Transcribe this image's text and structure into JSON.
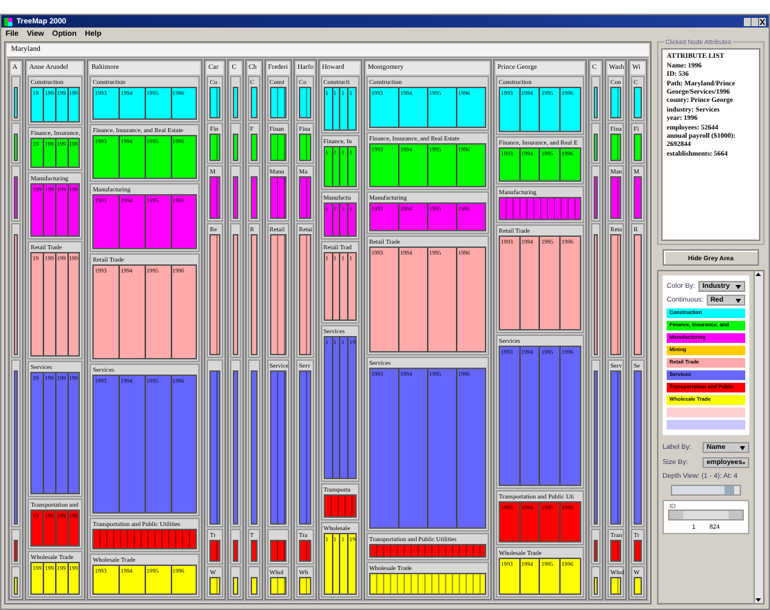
{
  "window": {
    "title": "TreeMap 2000"
  },
  "menu": [
    "File",
    "View",
    "Option",
    "Help"
  ],
  "treemap": {
    "root": "Maryland",
    "counties": [
      {
        "name": "A",
        "sectors": [
          {
            "color": "#00ffff"
          },
          {
            "color": "#00ff00"
          },
          {
            "color": "#ff00ff"
          },
          {
            "color": "#ffaaaa"
          },
          {
            "color": "#6666ff"
          },
          {
            "color": "#ff0000"
          },
          {
            "color": "#ffff00"
          }
        ]
      },
      {
        "name": "Anne Arundel",
        "sectors": [
          {
            "label": "Construction",
            "color": "#00ffff",
            "years": [
              "19",
              "199",
              "199",
              "199"
            ]
          },
          {
            "label": "Finance, Insurance,",
            "color": "#00ff00",
            "years": [
              "19",
              "199",
              "199",
              "199"
            ]
          },
          {
            "label": "Manufacturing",
            "color": "#ff00ff",
            "years": [
              "199",
              "199",
              "199",
              "199"
            ]
          },
          {
            "label": "Retail Trade",
            "color": "#ffaaaa",
            "years": [
              "19",
              "199",
              "199",
              "199"
            ]
          },
          {
            "label": "Services",
            "color": "#6666ff",
            "years": [
              "19",
              "199",
              "199",
              "199"
            ]
          },
          {
            "label": "Transportation and",
            "color": "#ff0000",
            "years": [
              "19",
              "199",
              "199",
              "199"
            ]
          },
          {
            "label": "Wholesale Trade",
            "color": "#ffff00",
            "years": [
              "199",
              "199",
              "199",
              "199"
            ]
          }
        ]
      },
      {
        "name": "Baltimore",
        "sectors": [
          {
            "label": "Construction",
            "color": "#00ffff",
            "years": [
              "1993",
              "1994",
              "1995",
              "1996"
            ]
          },
          {
            "label": "Finance, Insurance, and Real Estate",
            "color": "#00ff00",
            "years": [
              "1993",
              "1994",
              "1995",
              "1996"
            ]
          },
          {
            "label": "Manufacturing",
            "color": "#ff00ff",
            "years": [
              "1993",
              "1994",
              "1995",
              "1996"
            ]
          },
          {
            "label": "Retail Trade",
            "color": "#ffaaaa",
            "years": [
              "1993",
              "1994",
              "1995",
              "1996"
            ]
          },
          {
            "label": "Services",
            "color": "#6666ff",
            "years": [
              "1993",
              "1994",
              "1995",
              "1996"
            ]
          },
          {
            "label": "Transportation and Public Utilities",
            "color": "#ff0000"
          },
          {
            "label": "Wholesale Trade",
            "color": "#ffff00",
            "years": [
              "1993",
              "1994",
              "1995",
              "1996"
            ]
          }
        ]
      },
      {
        "name": "Car",
        "sectors": [
          {
            "label": "Co",
            "color": "#00ffff"
          },
          {
            "label": "Fin",
            "color": "#00ff00"
          },
          {
            "label": "M",
            "color": "#ff00ff"
          },
          {
            "label": "Re",
            "color": "#ffaaaa"
          },
          {
            "color": "#6666ff"
          },
          {
            "label": "Tr",
            "color": "#ff0000"
          },
          {
            "label": "W",
            "color": "#ffff00"
          }
        ]
      },
      {
        "name": "C",
        "sectors": [
          {
            "color": "#00ffff"
          },
          {
            "color": "#00ff00"
          },
          {
            "color": "#ff00ff"
          },
          {
            "color": "#ffaaaa"
          },
          {
            "color": "#6666ff"
          },
          {
            "color": "#ff0000"
          },
          {
            "color": "#ffff00"
          }
        ]
      },
      {
        "name": "Ch",
        "sectors": [
          {
            "label": "C",
            "color": "#00ffff"
          },
          {
            "label": "F",
            "color": "#00ff00"
          },
          {
            "color": "#ff00ff"
          },
          {
            "label": "R",
            "color": "#ffaaaa"
          },
          {
            "color": "#6666ff"
          },
          {
            "label": "T",
            "color": "#ff0000"
          },
          {
            "color": "#ffff00"
          }
        ]
      },
      {
        "name": "Frederi",
        "sectors": [
          {
            "label": "Const",
            "color": "#00ffff"
          },
          {
            "label": "Finan",
            "color": "#00ff00"
          },
          {
            "label": "Manu",
            "color": "#ff00ff"
          },
          {
            "label": "Retail",
            "color": "#ffaaaa"
          },
          {
            "label": "Service",
            "color": "#6666ff"
          },
          {
            "color": "#ff0000"
          },
          {
            "label": "Whol",
            "color": "#ffff00"
          }
        ]
      },
      {
        "name": "Harfo",
        "sectors": [
          {
            "label": "Co",
            "color": "#00ffff"
          },
          {
            "label": "Fina",
            "color": "#00ff00"
          },
          {
            "label": "Ma",
            "color": "#ff00ff"
          },
          {
            "label": "Retai",
            "color": "#ffaaaa"
          },
          {
            "label": "Serv",
            "color": "#6666ff"
          },
          {
            "label": "Tra",
            "color": "#ff0000"
          },
          {
            "label": "Wh",
            "color": "#ffff00"
          }
        ]
      },
      {
        "name": "Howard",
        "sectors": [
          {
            "label": "Constructi",
            "color": "#00ffff",
            "years": [
              "1",
              "1",
              "1",
              "1"
            ]
          },
          {
            "label": "Finance, In",
            "color": "#00ff00",
            "years": [
              "1",
              "1",
              "1",
              "1"
            ]
          },
          {
            "label": "Manufactu",
            "color": "#ff00ff",
            "years": [
              "1",
              "1",
              "1",
              "1"
            ]
          },
          {
            "label": "Retail Trad",
            "color": "#ffaaaa",
            "years": [
              "1",
              "1",
              "1",
              "1"
            ]
          },
          {
            "label": "Services",
            "color": "#6666ff",
            "years": [
              "1",
              "1",
              "1",
              "19"
            ]
          },
          {
            "label": "Transporta",
            "color": "#ff0000"
          },
          {
            "label": "Wholesale",
            "color": "#ffff00",
            "years": [
              "1",
              "1",
              "1",
              "19"
            ]
          }
        ]
      },
      {
        "name": "Montgomery",
        "sectors": [
          {
            "label": "Construction",
            "color": "#00ffff",
            "years": [
              "1993",
              "1994",
              "1995",
              "1996"
            ]
          },
          {
            "label": "Finance, Insurance, and Real Estate",
            "color": "#00ff00",
            "years": [
              "1993",
              "1994",
              "1995",
              "1996"
            ]
          },
          {
            "label": "Manufacturing",
            "color": "#ff00ff",
            "years": [
              "1993",
              "1994",
              "1995",
              "1996"
            ]
          },
          {
            "label": "Retail Trade",
            "color": "#ffaaaa",
            "years": [
              "1993",
              "1994",
              "1995",
              "1996"
            ]
          },
          {
            "label": "Services",
            "color": "#6666ff",
            "years": [
              "1993",
              "1994",
              "1995",
              "1996"
            ]
          },
          {
            "label": "Transportation and Public Utilities",
            "color": "#ff0000"
          },
          {
            "label": "Wholesale Trade",
            "color": "#ffff00"
          }
        ]
      },
      {
        "name": "Prince George",
        "sectors": [
          {
            "label": "Construction",
            "color": "#00ffff",
            "years": [
              "1993",
              "1994",
              "1995",
              "1996"
            ]
          },
          {
            "label": "Finance, Insurance, and Real E",
            "color": "#00ff00",
            "years": [
              "1993",
              "1994",
              "1995",
              "1996"
            ]
          },
          {
            "label": "Manufacturing",
            "color": "#ff00ff"
          },
          {
            "label": "Retail Trade",
            "color": "#ffaaaa",
            "years": [
              "1993",
              "1994",
              "1995",
              "1996"
            ]
          },
          {
            "label": "Services",
            "color": "#6666ff",
            "years": [
              "1993",
              "1994",
              "1995",
              "1996"
            ]
          },
          {
            "label": "Transportation and Public Uti",
            "color": "#ff0000",
            "years": [
              "1993",
              "1994",
              "1995",
              "1996"
            ]
          },
          {
            "label": "Wholesale Trade",
            "color": "#ffff00",
            "years": [
              "1993",
              "1994",
              "1995",
              "1996"
            ]
          }
        ]
      },
      {
        "name": "C",
        "sectors": [
          {
            "color": "#00ffff"
          },
          {
            "color": "#00ff00"
          },
          {
            "color": "#ff00ff"
          },
          {
            "color": "#ffaaaa"
          },
          {
            "color": "#6666ff"
          },
          {
            "color": "#ff0000"
          },
          {
            "color": "#ffff00"
          }
        ]
      },
      {
        "name": "Wash",
        "sectors": [
          {
            "label": "Con",
            "color": "#00ffff"
          },
          {
            "label": "Fina",
            "color": "#00ff00"
          },
          {
            "label": "Man",
            "color": "#ff00ff"
          },
          {
            "label": "Reta",
            "color": "#ffaaaa"
          },
          {
            "label": "Serv",
            "color": "#6666ff"
          },
          {
            "label": "Tran",
            "color": "#ff0000"
          },
          {
            "label": "Whol",
            "color": "#ffff00"
          }
        ]
      },
      {
        "name": "Wi",
        "sectors": [
          {
            "label": "C",
            "color": "#00ffff"
          },
          {
            "label": "Fi",
            "color": "#00ff00"
          },
          {
            "label": "M",
            "color": "#ff00ff"
          },
          {
            "label": "R",
            "color": "#ffaaaa"
          },
          {
            "label": "Se",
            "color": "#6666ff"
          },
          {
            "label": "Tr",
            "color": "#ff0000"
          },
          {
            "label": "W",
            "color": "#ffff00"
          }
        ]
      }
    ]
  },
  "attributes": {
    "title": "Clicked Node Attributes",
    "heading": "ATTRIBUTE LIST",
    "lines": [
      "Name: 1996",
      "ID: 536",
      "Path: Maryland/Prince George/Services/1996",
      "county: Prince George",
      "industry: Services",
      "year: 1996",
      "employees: 52644",
      "annual payroll ($1000): 2692844",
      "establishments: 5664"
    ]
  },
  "hide_button": "Hide Grey Area",
  "color_by": {
    "label": "Color By:",
    "value": "Industry"
  },
  "continuous": {
    "label": "Continuous:",
    "value": "Red"
  },
  "legend": [
    {
      "label": "Construction",
      "color": "#00ffff"
    },
    {
      "label": "Finance, Insurance, and",
      "color": "#00ff00"
    },
    {
      "label": "Manufacturing",
      "color": "#ff00ff"
    },
    {
      "label": "Mining",
      "color": "#ffcc00"
    },
    {
      "label": "Retail Trade",
      "color": "#ffaaaa"
    },
    {
      "label": "Services",
      "color": "#6666ff"
    },
    {
      "label": "Transportation and Public",
      "color": "#ff0000"
    },
    {
      "label": "Wholesale Trade",
      "color": "#ffff00"
    },
    {
      "color": "#ffd0d0"
    },
    {
      "color": "#c8c8ff"
    }
  ],
  "label_by": {
    "label": "Label By:",
    "value": "Name"
  },
  "size_by": {
    "label": "Size By:",
    "value": "employees"
  },
  "depth": {
    "label": "Depth View: (1 - 4): At: 4",
    "level": 0.92
  },
  "id_filter": {
    "title": "ID",
    "min": "1",
    "max": "824",
    "level": 1
  }
}
